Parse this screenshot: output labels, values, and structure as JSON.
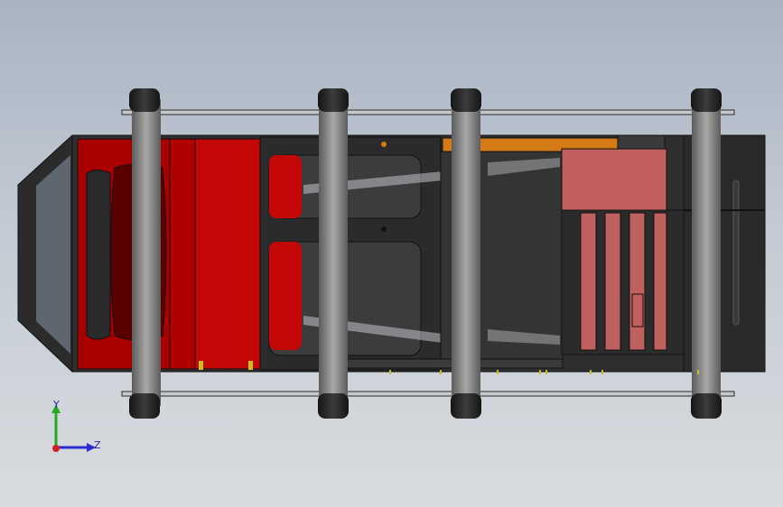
{
  "viewport": {
    "background_top": "#a9b4c3",
    "background_bottom": "#d9dcdf"
  },
  "model": {
    "frame_color": "#2b2b2b",
    "red_part_color": "#c00000",
    "pink_part_color": "#c0615f",
    "orange_rail_color": "#d47a17",
    "roller_color": "#8a8a8a",
    "roller_count": 4
  },
  "triad": {
    "y_label": "Y",
    "z_label": "Z",
    "y_axis_color": "#22aa22",
    "z_axis_color": "#2a2ad0",
    "x_axis_color": "#d02020"
  }
}
